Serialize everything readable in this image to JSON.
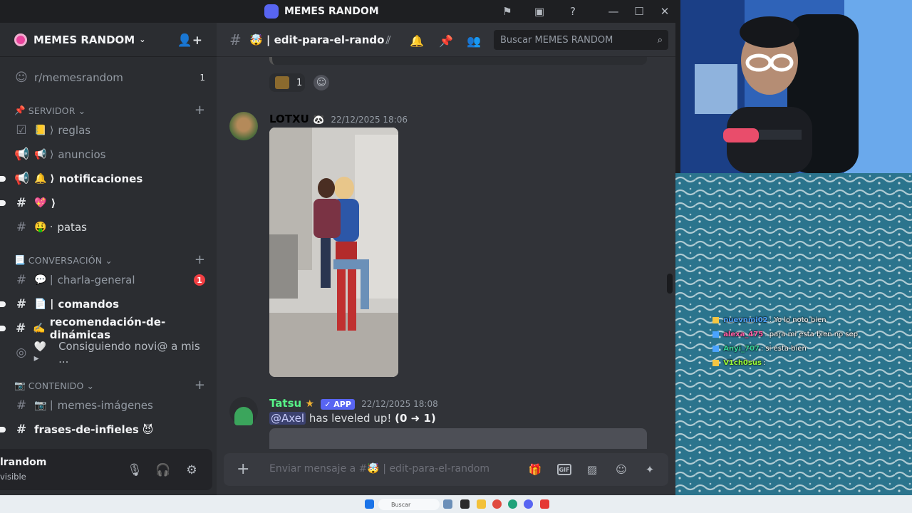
{
  "window": {
    "title": "MEMES RANDOM"
  },
  "server": {
    "name": "MEMES RANDOM"
  },
  "sidebar": {
    "channels": [
      {
        "name": "r/memesrandom",
        "count": "1"
      },
      {
        "name": "reglas",
        "emoji": "📒 ⟩"
      },
      {
        "name": "anuncios",
        "emoji": "📢 ⟩"
      },
      {
        "name": "notificaciones",
        "emoji": "🔔 ⟩"
      },
      {
        "name": "⟩",
        "emoji": "💖"
      },
      {
        "name": "patas",
        "emoji": "🤑 ·"
      },
      {
        "name": "charla-general",
        "emoji": "💬 |",
        "badge": "1"
      },
      {
        "name": "comandos",
        "emoji": "📄 |"
      },
      {
        "name": "recomendación-de-dinámicas",
        "emoji": "✍️"
      },
      {
        "name": "Consiguiendo novi@ a mis ...",
        "emoji": "🤍 ▸"
      },
      {
        "name": "memes-imágenes",
        "emoji": "📷 |"
      },
      {
        "name": "frases-de-infieles",
        "emoji": "😈"
      }
    ],
    "categories": {
      "servidor": "SERVIDOR",
      "conversacion": "CONVERSACIÓN",
      "contenido": "CONTENIDO"
    }
  },
  "user": {
    "name": "lrandom",
    "status": "visible"
  },
  "chat": {
    "channel_name": "| edit-para-el-rando",
    "search_placeholder": "Buscar MEMES RANDOM",
    "reaction_count": "1",
    "messages": [
      {
        "author": "LOTXU",
        "timestamp": "22/12/2025 18:06",
        "author_color": "#f2f3f5"
      },
      {
        "author": "Tatsu",
        "tag": "✓ APP",
        "timestamp": "22/12/2025 18:08",
        "author_color": "#57f287",
        "mention": "@Axel",
        "text": "has leveled up!",
        "bold": "(0 ➜ 1)"
      }
    ],
    "composer_placeholder": "Enviar mensaje a #🤯 | edit-para-el-random"
  },
  "stream_chat": [
    {
      "name": "nuevnmi02",
      "text": ": Yo lo noto bien",
      "color": "#4aa3ff"
    },
    {
      "name": "alexa_475",
      "text": ": para mi esta bien no sep",
      "color": "#ff5fa8"
    },
    {
      "name": "Anyi_707",
      "text": ": si esta bien",
      "color": "#34d399"
    },
    {
      "name": "V1ch0sus",
      "text": ": ",
      "color": "#9bff3a"
    }
  ],
  "taskbar": {
    "search_label": "Buscar"
  }
}
